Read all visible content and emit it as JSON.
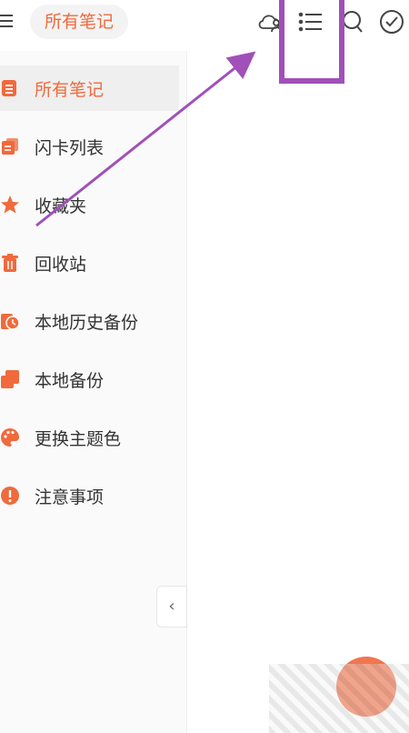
{
  "header": {
    "title": "所有笔记",
    "icons": [
      "menu-icon",
      "cloud-user-icon",
      "list-icon",
      "search-icon",
      "check-circle-icon"
    ]
  },
  "sidebar": {
    "items": [
      {
        "label": "所有笔记",
        "icon": "notes-icon",
        "active": true
      },
      {
        "label": "闪卡列表",
        "icon": "flashcard-icon",
        "active": false
      },
      {
        "label": "收藏夹",
        "icon": "star-icon",
        "active": false
      },
      {
        "label": "回收站",
        "icon": "trash-icon",
        "active": false
      },
      {
        "label": "本地历史备份",
        "icon": "history-icon",
        "active": false
      },
      {
        "label": "本地备份",
        "icon": "backup-icon",
        "active": false
      },
      {
        "label": "更换主题色",
        "icon": "palette-icon",
        "active": false
      },
      {
        "label": "注意事项",
        "icon": "alert-icon",
        "active": false
      }
    ],
    "collapse_glyph": "‹"
  },
  "colors": {
    "accent": "#f06a3c",
    "annotation": "#a050b8"
  }
}
